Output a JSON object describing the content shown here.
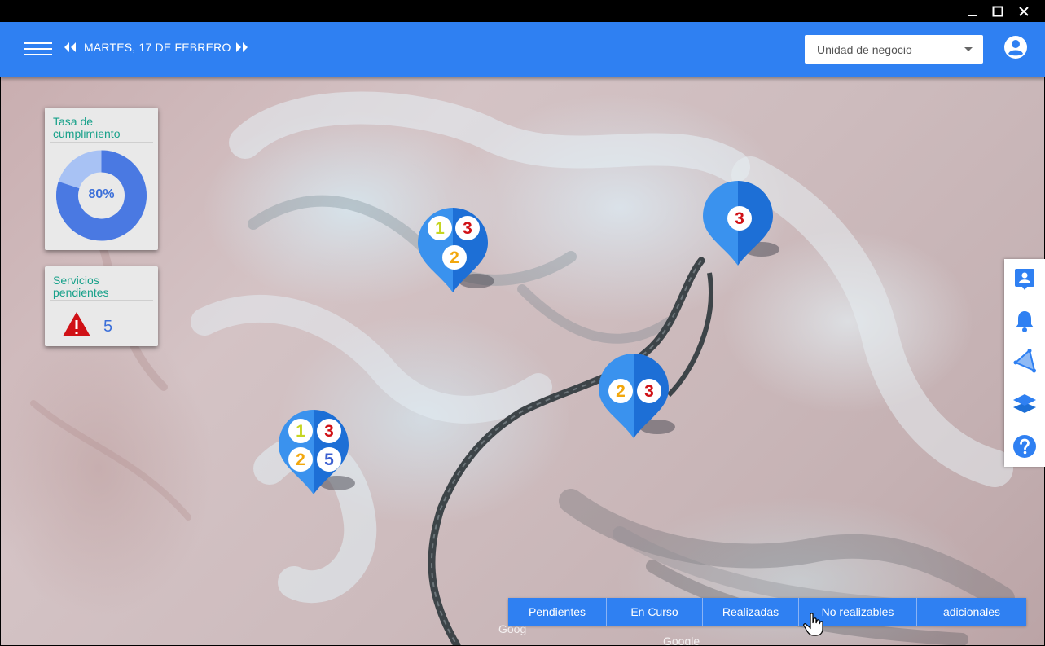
{
  "window": {
    "controls": [
      {
        "name": "minimize",
        "glyph": "—"
      },
      {
        "name": "maximize",
        "glyph": "☐"
      },
      {
        "name": "close",
        "glyph": "✕"
      }
    ]
  },
  "header": {
    "date_label": "MARTES, 17 DE FEBRERO",
    "business_unit_placeholder": "Unidad de negocio",
    "accent_color": "#2f80f2",
    "icons": [
      "menu-icon",
      "previous-arrow-icon",
      "next-arrow-icon",
      "dropdown-caret-icon",
      "user-account-icon"
    ]
  },
  "compliance_card": {
    "title": "Tasa de cumplimiento",
    "percent_label": "80%",
    "percent": 80,
    "colors": {
      "filled": "#4a79e2",
      "remaining": "#a8c2f4"
    }
  },
  "pending_card": {
    "title": "Servicios pendientes",
    "value": "5",
    "icon": "warning-icon",
    "icon_color": "#d01116"
  },
  "markers": [
    {
      "badges": [
        "1",
        "3",
        "2"
      ],
      "badge_colors": [
        "#c6d521",
        "#d01116",
        "#f2a70d"
      ]
    },
    {
      "badges": [
        "3"
      ],
      "badge_colors": [
        "#d01116"
      ]
    },
    {
      "badges": [
        "2",
        "3"
      ],
      "badge_colors": [
        "#f2a70d",
        "#d01116"
      ]
    },
    {
      "badges": [
        "1",
        "3",
        "2",
        "5"
      ],
      "badge_colors": [
        "#c6d521",
        "#d01116",
        "#f2a70d",
        "#3b5fd0"
      ]
    }
  ],
  "sidebar": {
    "buttons": [
      "contact-card-icon",
      "bell-icon",
      "area-triangle-icon",
      "layers-icon",
      "help-icon"
    ]
  },
  "status_tabs": [
    "Pendientes",
    "En Curso",
    "Realizadas",
    "No realizables",
    "adicionales"
  ],
  "map": {
    "watermarks": [
      "Goog",
      "Google"
    ]
  }
}
